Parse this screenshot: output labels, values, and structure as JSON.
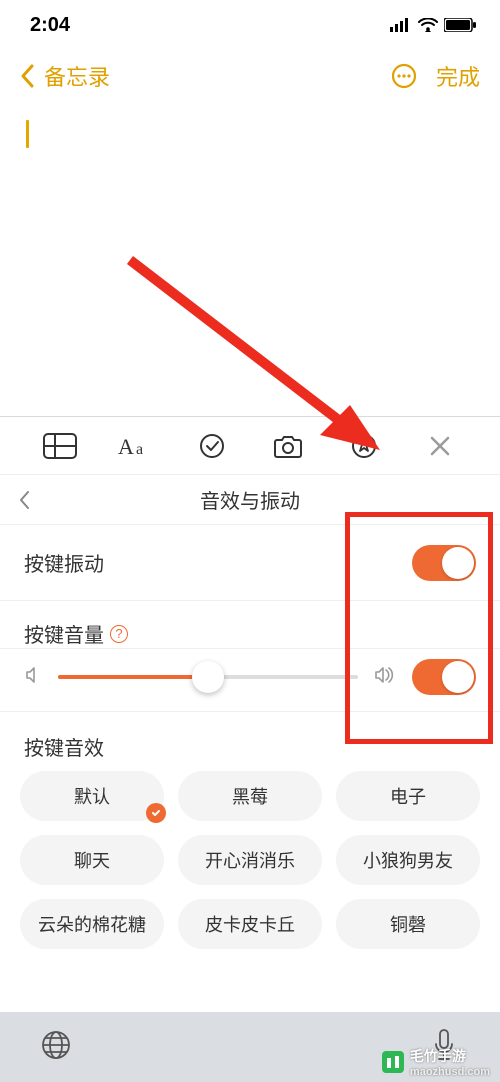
{
  "status": {
    "time": "2:04"
  },
  "nav": {
    "back_label": "备忘录",
    "done_label": "完成"
  },
  "accent": "#e6a600",
  "toggle_color": "#ef6a33",
  "highlight_color": "#eb2c1e",
  "panel": {
    "title": "音效与振动",
    "vibration_label": "按键振动",
    "volume_label": "按键音量",
    "volume_fraction": 0.5,
    "effects_label": "按键音效"
  },
  "chips": [
    {
      "label": "默认",
      "selected": true
    },
    {
      "label": "黑莓",
      "selected": false
    },
    {
      "label": "电子",
      "selected": false
    },
    {
      "label": "聊天",
      "selected": false
    },
    {
      "label": "开心消消乐",
      "selected": false
    },
    {
      "label": "小狼狗男友",
      "selected": false
    },
    {
      "label": "云朵的棉花糖",
      "selected": false
    },
    {
      "label": "皮卡皮卡丘",
      "selected": false
    },
    {
      "label": "铜磬",
      "selected": false
    }
  ],
  "watermark": {
    "brand": "毛竹手游",
    "url": "maozhusd.com"
  }
}
